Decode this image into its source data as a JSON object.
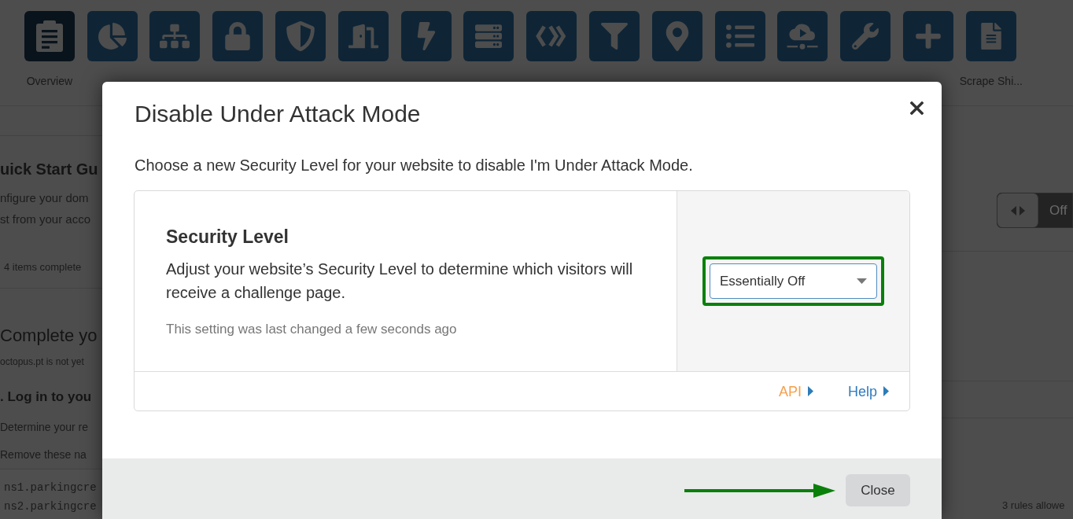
{
  "nav": {
    "items": [
      {
        "label": "Overview",
        "selected": true
      },
      {
        "selected": false
      },
      {
        "selected": false
      },
      {
        "selected": false
      },
      {
        "selected": false
      },
      {
        "selected": false
      },
      {
        "selected": false
      },
      {
        "selected": false
      },
      {
        "selected": false
      },
      {
        "selected": false
      },
      {
        "selected": false
      },
      {
        "selected": false
      },
      {
        "selected": false
      },
      {
        "selected": false
      },
      {
        "selected": false
      },
      {
        "label": "Scrape Shi...",
        "selected": false
      }
    ]
  },
  "quick_start": {
    "title": "uick Start Gu",
    "description_lines": [
      "nfigure your dom",
      "st from your acco"
    ],
    "progress": "4 items complete"
  },
  "setup": {
    "title": "Complete yo",
    "note": "octopus.pt is not yet",
    "step_title": ". Log in to you",
    "step_lines": [
      "Determine your re",
      "Remove these na"
    ],
    "nameservers": [
      "ns1.parkingcre",
      "ns2.parkingcre"
    ]
  },
  "side_panel": {
    "toggle": {
      "label": "Off",
      "on": false
    },
    "rules_note": "3 rules allowe"
  },
  "dialog": {
    "title": "Disable Under Attack Mode",
    "intro": "Choose a new Security Level for your website to disable I'm Under Attack Mode.",
    "setting": {
      "title": "Security Level",
      "description": "Adjust your website’s Security Level to determine which visitors will receive a challenge page.",
      "last_changed": "This setting was last changed a few seconds ago",
      "select": {
        "value": "Essentially Off",
        "highlighted": true
      },
      "links": [
        {
          "label": "API",
          "kind": "api"
        },
        {
          "label": "Help",
          "kind": "help"
        }
      ]
    },
    "close_button": {
      "label": "Close",
      "arrow_pointer": true
    }
  }
}
